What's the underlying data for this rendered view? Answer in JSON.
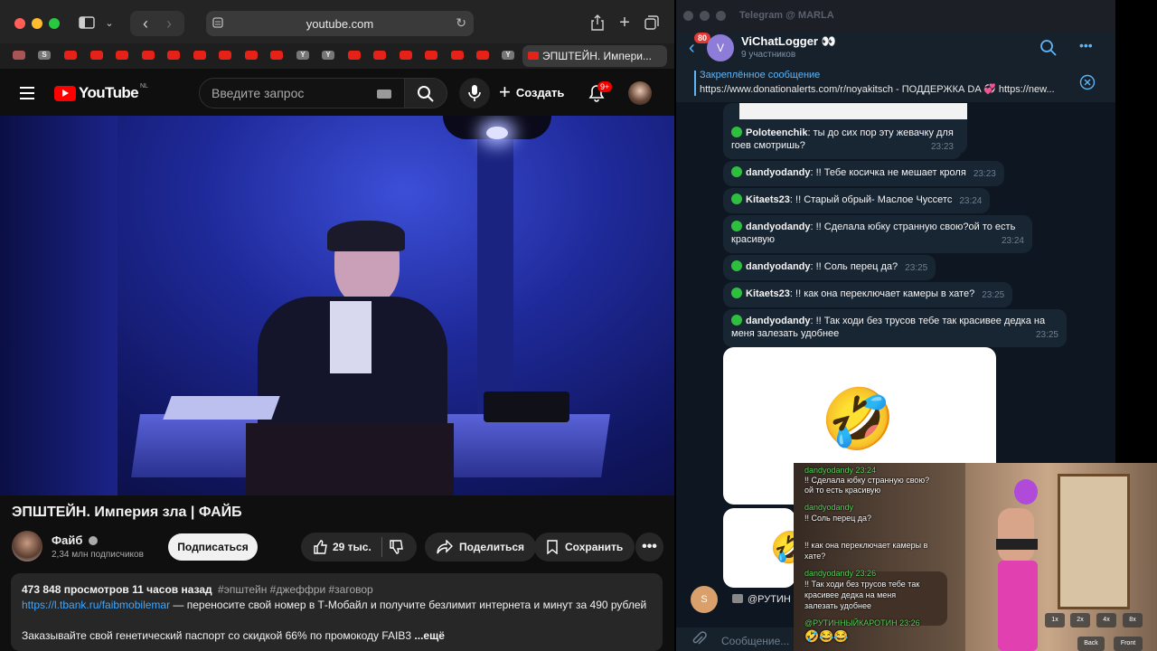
{
  "safari": {
    "url": "youtube.com",
    "active_tab_title": "ЭПШТЕЙН. Импери..."
  },
  "youtube": {
    "logo_text": "YouTube",
    "region": "NL",
    "search_placeholder": "Введите запрос",
    "create_label": "Создать",
    "notifications_badge": "9+",
    "video_title": "ЭПШТЕЙН. Империя зла | ФАЙБ",
    "channel_name": "Файб",
    "subscribers": "2,34 млн подписчиков",
    "subscribe_label": "Подписаться",
    "likes": "29 тыс.",
    "share_label": "Поделиться",
    "save_label": "Сохранить",
    "description": {
      "stats": "473 848 просмотров  11 часов назад",
      "tags": "#эпштейн #джеффри #заговор",
      "link": "https://l.tbank.ru/faibmobilemar",
      "link_text": " — переносите свой номер в Т-Мобайл и получите безлимит интернета и минут за 490 рублей",
      "line3": "Заказывайте свой генетический паспорт со скидкой 66% по промокоду FAIB3",
      "more": " ...ещё"
    }
  },
  "telegram": {
    "window_title": "Telegram @ MARLA",
    "back_badge": "80",
    "chat_name": "ViChatLogger 👀",
    "avatar_letter": "V",
    "members": "9 участников",
    "pinned_label": "Закреплённое сообщение",
    "pinned_text": "https://www.donationalerts.com/r/noyakitsch - ПОДДЕРЖКА DA 💞 https://new...",
    "messages": [
      {
        "name": "Poloteenchik",
        "text": ": ты до сих пор эту жевачку для гоев смотришь?",
        "time": "23:23"
      },
      {
        "name": "dandyodandy",
        "text": ": !! Тебе косичка не мешает кроля",
        "time": "23:23"
      },
      {
        "name": "Kitaets23",
        "text": ": !! Старый обрый- Маслое Чуссетс",
        "time": "23:24"
      },
      {
        "name": "dandyodandy",
        "text": ": !! Сделала юбку странную свою?ой то есть красивую",
        "time": "23:24"
      },
      {
        "name": "dandyodandy",
        "text": ": !! Соль перец да?",
        "time": "23:25"
      },
      {
        "name": "Kitaets23",
        "text": ": !! как она переключает камеры в хате?",
        "time": "23:25"
      },
      {
        "name": "dandyodandy",
        "text": ": !! Так ходи без трусов тебе так красивее дедка на меня залезать  удобнее",
        "time": "23:25"
      }
    ],
    "sticker": "🤣",
    "last_sender_letter": "S",
    "last_preview": "@РУТИН",
    "composer_placeholder": "Сообщение..."
  },
  "overlay": {
    "lines": [
      {
        "text": "dandyodandy 23:24",
        "color": "#5cd65c"
      },
      {
        "text": "!! Сделала юбку странную свою?",
        "color": "#ffffff"
      },
      {
        "text": "ой то есть красивую",
        "color": "#ffffff"
      },
      {
        "text": "dandyodandy",
        "color": "#5cd65c"
      },
      {
        "text": "!! Соль перец да?",
        "color": "#ffffff"
      },
      {
        "text": "!! как она переключает камеры в",
        "color": "#ffffff"
      },
      {
        "text": "хате?",
        "color": "#ffffff"
      },
      {
        "text": "dandyodandy 23:26",
        "color": "#5cd65c"
      },
      {
        "text": "!! Так ходи без трусов тебе так",
        "color": "#ffffff"
      },
      {
        "text": "красивее дедка на меня",
        "color": "#ffffff"
      },
      {
        "text": "залезать удобнее",
        "color": "#ffffff"
      },
      {
        "text": "@РУТИННЫЙКАРОТИН 23:26",
        "color": "#5cd65c"
      },
      {
        "text": "🤣😂😂",
        "color": "#ffffff"
      }
    ],
    "speed_options": [
      "1x",
      "2x",
      "4x",
      "8x"
    ],
    "back_label": "Back",
    "front_label": "Front"
  }
}
